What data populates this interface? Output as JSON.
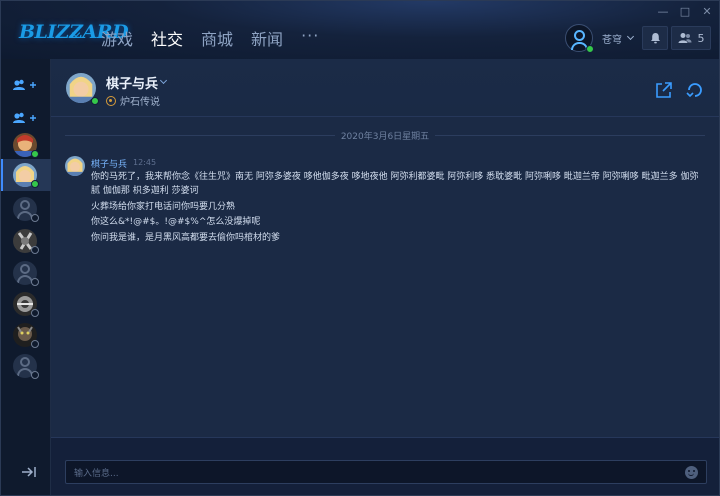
{
  "app": {
    "logo": "BLIZZARD",
    "nav": [
      "游戏",
      "社交",
      "商城",
      "新闻"
    ],
    "nav_more": "···",
    "user_name": "苍穹",
    "friends_count": "5",
    "accent_color": "#1a9be6",
    "online_color": "#35c84a"
  },
  "chat": {
    "name": "棋子与兵",
    "game": "炉石传说",
    "date": "2020年3月6日星期五",
    "message": {
      "author": "棋子与兵",
      "time": "12:45",
      "lines": [
        "你的马死了，我来帮你念《往生咒》南无 阿弥多婆夜 哆他伽多夜 哆地夜他 阿弥利都婆毗 阿弥利哆 悉耽婆毗 阿弥唎哆 毗迦兰帝 阿弥唎哆 毗迦兰多 伽弥腻 伽伽那 枳多迦利 莎婆诃",
        "火葬场给你家打电话问你吗要几分熟",
        "你这么&*!@#$。!@#$%^怎么没爆掉呢",
        "你问我是谁，是月黑风高都要去偷你吗棺材的爹"
      ]
    },
    "input_placeholder": "输入信息..."
  }
}
